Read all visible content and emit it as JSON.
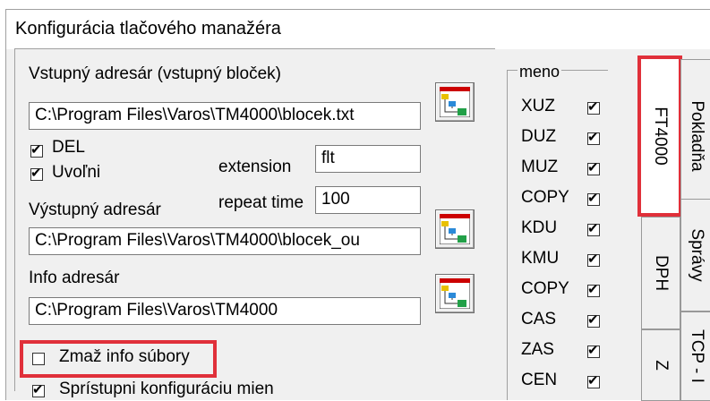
{
  "window": {
    "title": "Konfigurácia tlačového manažéra"
  },
  "input_dir": {
    "label": "Vstupný adresár (vstupný bloček)",
    "value": "C:\\Program Files\\Varos\\TM4000\\blocek.txt"
  },
  "options": {
    "del": {
      "label": "DEL",
      "checked": true
    },
    "uvolni": {
      "label": "Uvoľni",
      "checked": true
    },
    "extension_label": "extension",
    "extension_value": "flt",
    "repeat_label": "repeat time",
    "repeat_value": "100"
  },
  "output_dir": {
    "label": "Výstupný adresár",
    "value": "C:\\Program Files\\Varos\\TM4000\\blocek_ou"
  },
  "info_dir": {
    "label": "Info adresár",
    "value": "C:\\Program Files\\Varos\\TM4000"
  },
  "zmaz": {
    "label": "Zmaž info súbory",
    "checked": false
  },
  "spristupni": {
    "label": "Sprístupni konfiguráciu mien",
    "checked": true
  },
  "names": {
    "group_label": "meno",
    "items": [
      {
        "label": "XUZ",
        "checked": true
      },
      {
        "label": "DUZ",
        "checked": true
      },
      {
        "label": "MUZ",
        "checked": true
      },
      {
        "label": "COPY",
        "checked": true
      },
      {
        "label": "KDU",
        "checked": true
      },
      {
        "label": "KMU",
        "checked": true
      },
      {
        "label": "COPY",
        "checked": true
      },
      {
        "label": "CAS",
        "checked": true
      },
      {
        "label": "ZAS",
        "checked": true
      },
      {
        "label": "CEN",
        "checked": true
      }
    ]
  },
  "tabs": {
    "ft4000": "FT4000",
    "pokladna": "Pokladňa",
    "dph": "DPH",
    "spravy": "Správy",
    "tcp": "TCP - I",
    "z": "Z"
  }
}
